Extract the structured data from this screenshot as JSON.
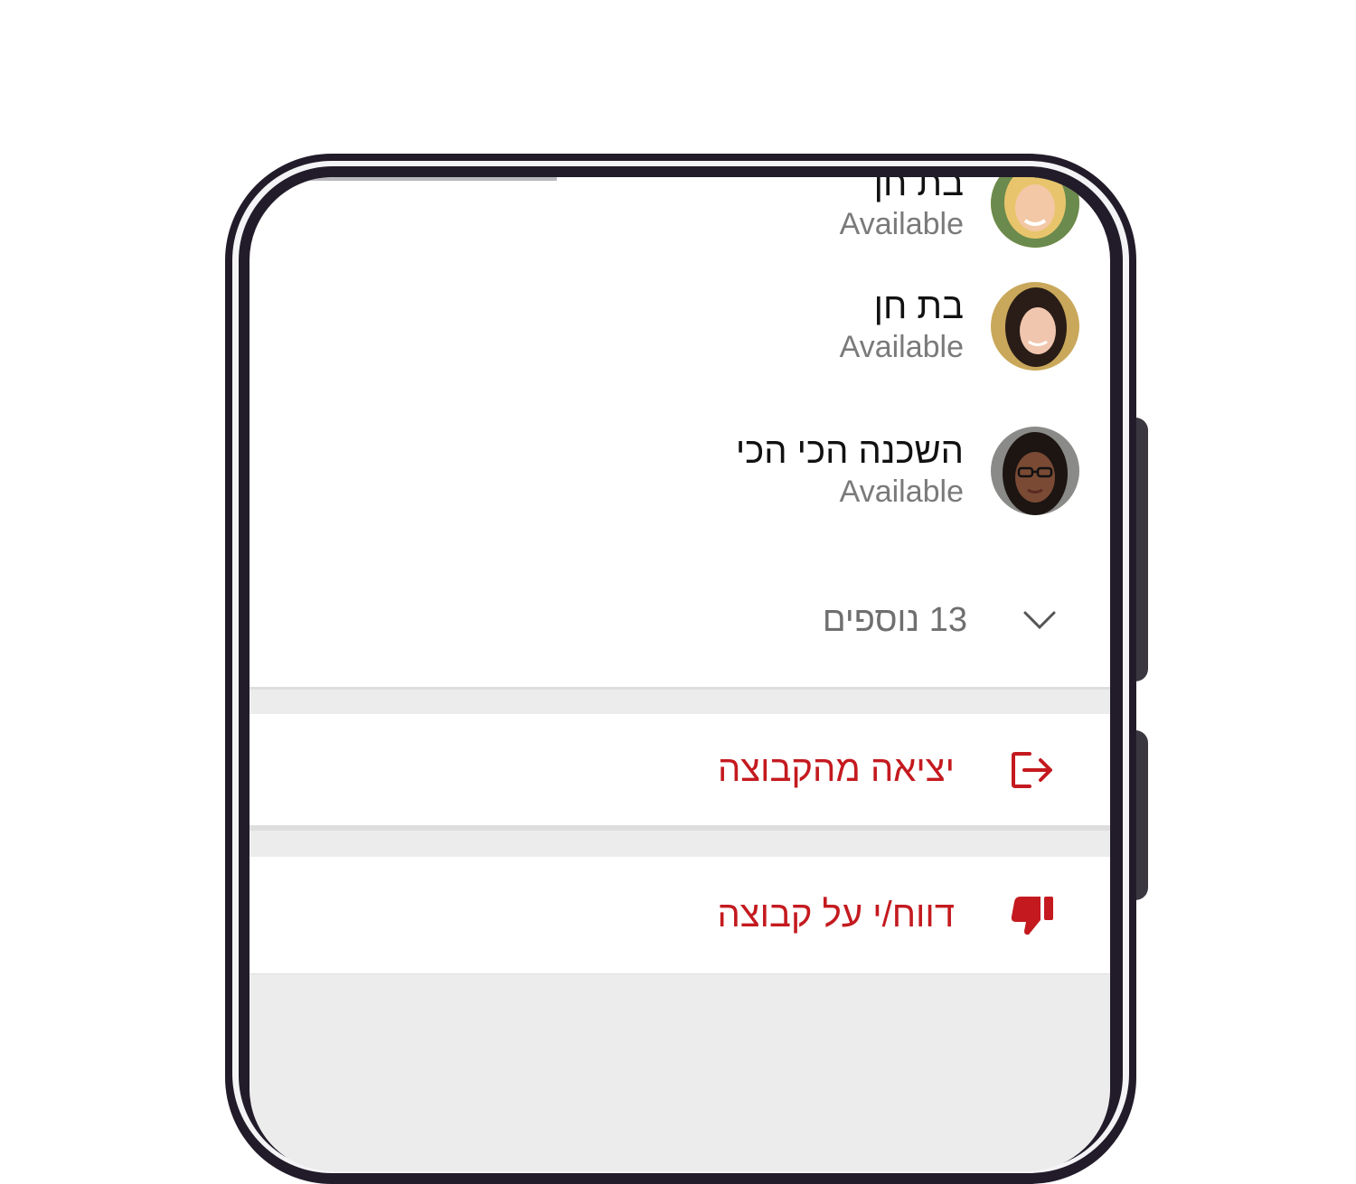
{
  "members": [
    {
      "name": "בת חן",
      "status": "Available",
      "avatar": "avatar-blonde-woman"
    },
    {
      "name": "בת חן",
      "status": "Available",
      "avatar": "avatar-dark-hair-woman"
    },
    {
      "name": "השכנה הכי הכי",
      "status": "Available",
      "avatar": "avatar-woman-glasses"
    }
  ],
  "more": {
    "label": "13 נוספים",
    "icon": "chevron-down-icon"
  },
  "actions": {
    "leave": {
      "label": "יציאה מהקבוצה",
      "icon": "exit-icon",
      "color": "#c41a1f"
    },
    "report": {
      "label": "דווח/י על קבוצה",
      "icon": "thumbs-down-icon",
      "color": "#c41a1f"
    }
  }
}
